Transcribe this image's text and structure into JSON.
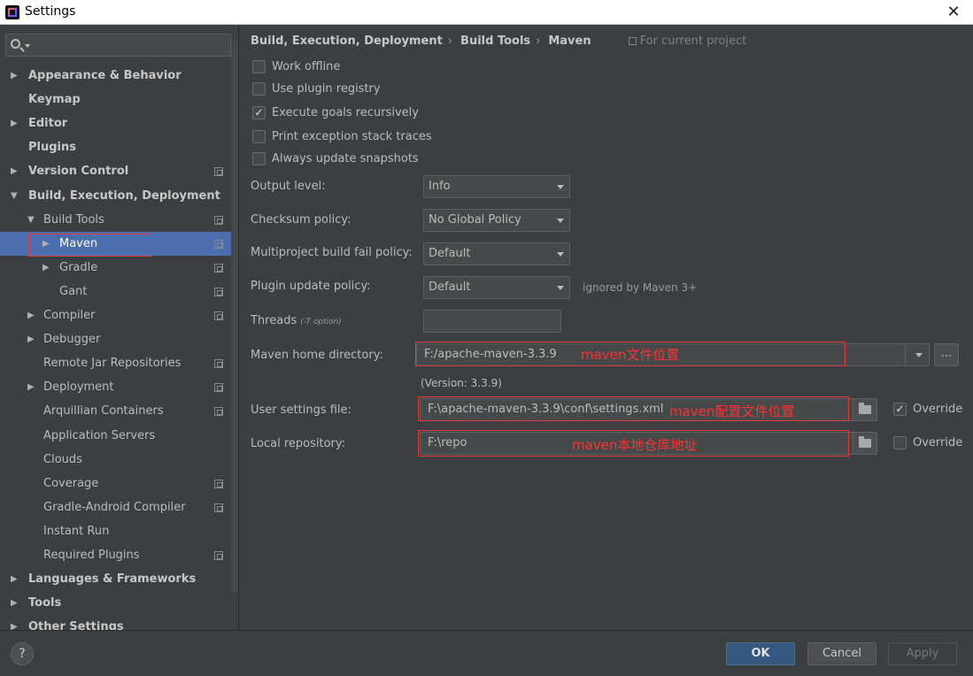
{
  "window": {
    "title": "Settings",
    "close_glyph": "✕"
  },
  "sidebar": {
    "search_placeholder": "",
    "items": [
      {
        "label": "Appearance & Behavior",
        "bold": true,
        "arrow": "▶",
        "level": 0,
        "project": false
      },
      {
        "label": "Keymap",
        "bold": true,
        "arrow": "",
        "level": 0,
        "project": false
      },
      {
        "label": "Editor",
        "bold": true,
        "arrow": "▶",
        "level": 0,
        "project": false
      },
      {
        "label": "Plugins",
        "bold": true,
        "arrow": "",
        "level": 0,
        "project": false
      },
      {
        "label": "Version Control",
        "bold": true,
        "arrow": "▶",
        "level": 0,
        "project": true
      },
      {
        "label": "Build, Execution, Deployment",
        "bold": true,
        "arrow": "▼",
        "level": 0,
        "project": false
      },
      {
        "label": "Build Tools",
        "bold": false,
        "arrow": "▼",
        "level": 1,
        "project": true
      },
      {
        "label": "Maven",
        "bold": false,
        "arrow": "▶",
        "level": 2,
        "project": true,
        "selected": true
      },
      {
        "label": "Gradle",
        "bold": false,
        "arrow": "▶",
        "level": 2,
        "project": true
      },
      {
        "label": "Gant",
        "bold": false,
        "arrow": "",
        "level": 2,
        "project": true
      },
      {
        "label": "Compiler",
        "bold": false,
        "arrow": "▶",
        "level": 1,
        "project": true
      },
      {
        "label": "Debugger",
        "bold": false,
        "arrow": "▶",
        "level": 1,
        "project": false
      },
      {
        "label": "Remote Jar Repositories",
        "bold": false,
        "arrow": "",
        "level": 1,
        "project": true
      },
      {
        "label": "Deployment",
        "bold": false,
        "arrow": "▶",
        "level": 1,
        "project": true
      },
      {
        "label": "Arquillian Containers",
        "bold": false,
        "arrow": "",
        "level": 1,
        "project": true
      },
      {
        "label": "Application Servers",
        "bold": false,
        "arrow": "",
        "level": 1,
        "project": false
      },
      {
        "label": "Clouds",
        "bold": false,
        "arrow": "",
        "level": 1,
        "project": false
      },
      {
        "label": "Coverage",
        "bold": false,
        "arrow": "",
        "level": 1,
        "project": true
      },
      {
        "label": "Gradle-Android Compiler",
        "bold": false,
        "arrow": "",
        "level": 1,
        "project": true
      },
      {
        "label": "Instant Run",
        "bold": false,
        "arrow": "",
        "level": 1,
        "project": false
      },
      {
        "label": "Required Plugins",
        "bold": false,
        "arrow": "",
        "level": 1,
        "project": true
      },
      {
        "label": "Languages & Frameworks",
        "bold": true,
        "arrow": "▶",
        "level": 0,
        "project": false
      },
      {
        "label": "Tools",
        "bold": true,
        "arrow": "▶",
        "level": 0,
        "project": false
      },
      {
        "label": "Other Settings",
        "bold": true,
        "arrow": "▶",
        "level": 0,
        "project": false
      }
    ]
  },
  "breadcrumb": {
    "parts": [
      "Build, Execution, Deployment",
      "Build Tools",
      "Maven"
    ],
    "separator": "›",
    "project_note": "For current project"
  },
  "options": {
    "work_offline": {
      "label": "Work offline",
      "checked": false
    },
    "plugin_registry": {
      "label": "Use plugin registry",
      "checked": false
    },
    "execute_goals": {
      "label": "Execute goals recursively",
      "checked": true
    },
    "print_exception": {
      "label": "Print exception stack traces",
      "checked": false
    },
    "update_snapshots": {
      "label": "Always update snapshots",
      "checked": false
    }
  },
  "fields": {
    "output_level": {
      "label": "Output level:",
      "value": "Info"
    },
    "checksum_policy": {
      "label": "Checksum policy:",
      "value": "No Global Policy"
    },
    "fail_policy": {
      "label": "Multiproject build fail policy:",
      "value": "Default"
    },
    "plugin_update": {
      "label": "Plugin update policy:",
      "value": "Default",
      "note": "ignored by Maven 3+"
    },
    "threads": {
      "label": "Threads",
      "hint": "(-T option)",
      "value": ""
    },
    "maven_home": {
      "label": "Maven home directory:",
      "value": "F:/apache-maven-3.3.9",
      "version": "(Version: 3.3.9)",
      "browse": "..."
    },
    "settings_file": {
      "label": "User settings file:",
      "value": "F:\\apache-maven-3.3.9\\conf\\settings.xml",
      "override_label": "Override",
      "override": true
    },
    "local_repo": {
      "label": "Local repository:",
      "value": "F:\\repo",
      "override_label": "Override",
      "override": false
    }
  },
  "annotations": {
    "home": "maven文件位置",
    "settings": "maven配置文件位置",
    "repo": "maven本地仓库地址"
  },
  "footer": {
    "help": "?",
    "ok": "OK",
    "cancel": "Cancel",
    "apply": "Apply"
  }
}
